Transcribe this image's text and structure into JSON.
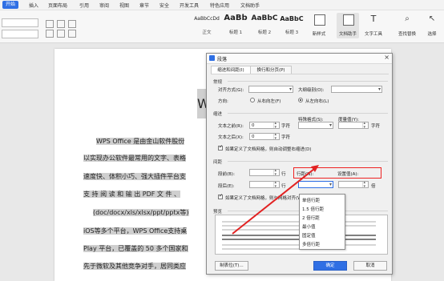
{
  "menubar": {
    "start_tab": "开始",
    "items": [
      "插入",
      "页面布局",
      "引用",
      "审阅",
      "视图",
      "章节",
      "安全",
      "开发工具",
      "特色应用",
      "文档助手"
    ]
  },
  "ribbon": {
    "styles": [
      {
        "sample": "AaBbCcDd",
        "name": "正文"
      },
      {
        "sample": "AaBb",
        "name": "标题 1"
      },
      {
        "sample": "AaBbC",
        "name": "标题 2"
      },
      {
        "sample": "AaBbC",
        "name": "标题 3"
      }
    ],
    "buttons": [
      {
        "label": "新样式",
        "icon": "new-style-icon"
      },
      {
        "label": "文档助手",
        "icon": "doc-assistant-icon"
      },
      {
        "label": "文字工具",
        "icon": "text-tools-icon"
      },
      {
        "label": "查找替换",
        "icon": "find-replace-icon"
      },
      {
        "label": "选择",
        "icon": "select-icon"
      }
    ]
  },
  "document": {
    "heading_fragment": "W",
    "lines": [
      "WPS Office 是由金山软件股份",
      "以实现办公软件最常用的文字、表格",
      "速度快、体积小巧、强大插件平台支",
      "支 持 阅 读 和 输 出 PDF 文 件 、",
      "(doc/docx/xls/xlsx/ppt/pptx等)",
      "iOS等多个平台，WPS Office支持桌",
      "Play 平台，已覆盖的 50 多个国家和",
      "先于微软及其他竞争对手，居同类应"
    ]
  },
  "dialog": {
    "title": "段落",
    "tabs": [
      "缩进和间距(I)",
      "换行和分页(P)"
    ],
    "general": {
      "section": "常规",
      "alignment_label": "对齐方式(G):",
      "alignment_value": "",
      "outline_label": "大纲级别(O):",
      "outline_value": "",
      "direction_label": "方向:",
      "rtl_label": "从右向左(F)",
      "ltr_label": "从左向右(L)"
    },
    "indent": {
      "section": "缩进",
      "before_label": "文本之前(R):",
      "before_value": "0",
      "before_unit": "字符",
      "special_label": "特殊格式(S):",
      "special_value": "",
      "measure_label": "度量值(Y):",
      "measure_unit": "字符",
      "after_label": "文本之后(X):",
      "after_value": "0",
      "after_unit": "字符",
      "grid_check_label": "如果定义了文档网格，则自动调整右缩进(D)"
    },
    "spacing": {
      "section": "间距",
      "before_label": "段前(B):",
      "before_unit": "行",
      "after_label": "段后(E):",
      "after_unit": "行",
      "line_label": "行距(N):",
      "setting_label": "设置值(A):",
      "setting_unit": "倍",
      "grid_check_label": "如果定义了文档网格，则与网格对齐(W)",
      "line_options": [
        "单倍行距",
        "1.5 倍行距",
        "2 倍行距",
        "最小值",
        "固定值",
        "多倍行距"
      ]
    },
    "preview": {
      "section": "预览"
    },
    "buttons": {
      "tabs": "制表位(T)...",
      "ok": "确定",
      "cancel": "取消"
    }
  },
  "colors": {
    "accent": "#2f6fe4",
    "highlight_red": "#e22222"
  }
}
